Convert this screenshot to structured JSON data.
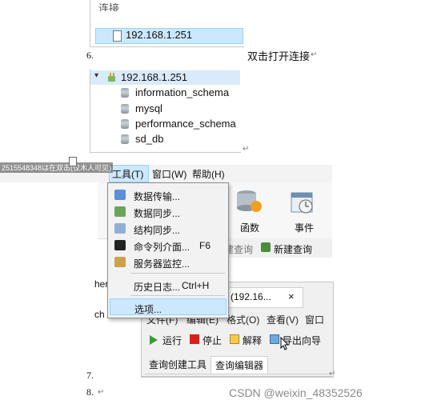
{
  "doc": {
    "top_cut_label": "连接",
    "step6": "6.",
    "step6_text": "双击打开连接",
    "step7": "7.",
    "step8": "8.",
    "para_mark": "↵",
    "side_cut_1": "her",
    "side_cut_2": "ch",
    "overlay_id": "2515548348は在双击(仅木人可见)"
  },
  "connection_tree": {
    "selected": "192.168.1.251"
  },
  "db_tree": {
    "connection": "192.168.1.251",
    "databases": [
      "information_schema",
      "mysql",
      "performance_schema",
      "sd_db"
    ]
  },
  "menubar": {
    "tools": "工具(T)",
    "window": "窗口(W)",
    "help": "帮助(H)"
  },
  "toolbar": {
    "function_label": "函数",
    "event_label": "事件",
    "query_cut": "建查询",
    "new_query": "新建查询"
  },
  "tools_menu": {
    "items": [
      {
        "label": "数据传输...",
        "shortcut": ""
      },
      {
        "label": "数据同步...",
        "shortcut": ""
      },
      {
        "label": "结构同步...",
        "shortcut": ""
      },
      {
        "label": "命令列介面...",
        "shortcut": "F6"
      },
      {
        "label": "服务器监控...",
        "shortcut": ""
      },
      {
        "label": "历史日志...",
        "shortcut": "Ctrl+H"
      },
      {
        "label": "选项...",
        "shortcut": ""
      }
    ]
  },
  "query_window": {
    "tab_title": "(192.16...",
    "tab_close": "×",
    "menu": [
      "文件(F)",
      "编辑(E)",
      "格式(O)",
      "查看(V)",
      "窗口"
    ],
    "tools": [
      "运行",
      "停止",
      "解释",
      "导出向导"
    ],
    "tabs": [
      "查询创建工具",
      "查询编辑器"
    ]
  },
  "watermark": "CSDN @weixin_48352526"
}
